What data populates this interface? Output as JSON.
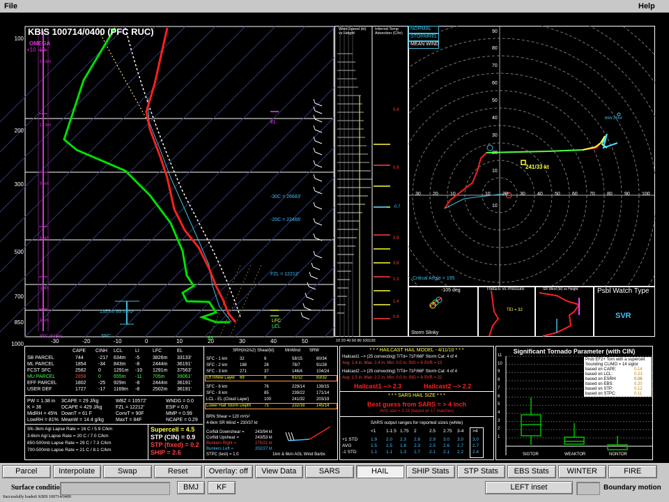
{
  "menu": {
    "file": "File",
    "help": "Help"
  },
  "skewt": {
    "title": "KBIS   100714/0400  (PFC RUC)",
    "omega_label": "OMEGA",
    "omega_scale": "+10   -10",
    "p_labels": [
      "100",
      "200",
      "300",
      "500",
      "700",
      "850",
      "1000"
    ],
    "t_labels": [
      "-30",
      "-20",
      "-10",
      "0",
      "10",
      "20",
      "30",
      "40",
      "50"
    ],
    "h_labels": [
      "15 km",
      "12 km",
      "9 km",
      "6 km",
      "3 km",
      "1 km",
      "SFC (532m)"
    ],
    "ann": {
      "el": "EL",
      "m30": "-30C = 26683'",
      "m20": "-20C = 22466'",
      "fzl": "FZL = 12212'",
      "lfc": "LFC",
      "lcl": "LCL",
      "sfc": "SFC",
      "srh": "1357m   69 m²/s²",
      "sixty": "63"
    }
  },
  "wind": {
    "label": "Wind Speed (kt) vs Height",
    "axis": "10 20 40 60 80 100120"
  },
  "tadv": {
    "label": "Inferred Temp Advection (C/hr)",
    "vals": [
      "0.4",
      "0.9",
      "-0.7",
      "3.9",
      "3.9",
      "2.3",
      "1.4",
      "0.9"
    ]
  },
  "hodo": {
    "tabs": [
      "NORMAL",
      "STORMREL",
      "MEAN WIND"
    ],
    "y_ticks": [
      "90",
      "80",
      "70",
      "60",
      "50",
      "40",
      "30",
      "20",
      "10",
      "10"
    ],
    "x_ticks": [
      "30",
      "20",
      "10",
      "10",
      "20",
      "30",
      "40",
      "50",
      "60",
      "70",
      "80",
      "90",
      "100"
    ],
    "mark": "241/33 kt",
    "critical": "Critical Angle = 195",
    "brn": "BRN 24/54"
  },
  "thetae": {
    "angle": "-105 deg",
    "title": "Theta-E vs Pressure",
    "tei": "TEI = 32",
    "slinky": "Storm Slinky",
    "p": [
      "-500",
      "-600",
      "-700",
      "-800",
      "-900"
    ]
  },
  "srwind": {
    "title": "SR Wind (kt) vs Height"
  },
  "watch": {
    "title": "Psbl Watch Type",
    "value": "SVR"
  },
  "params": {
    "header": [
      "CAPE",
      "CINH",
      "LCL",
      "LI",
      "LFC",
      "EL"
    ],
    "rows": [
      [
        "SB PARCEL",
        "744",
        "-217",
        "634m",
        "-5",
        "3826m",
        "33133'"
      ],
      [
        "ML PARCEL",
        "1854",
        "-34",
        "843m",
        "-8",
        "2444m",
        "36191'"
      ],
      [
        "FCST SFC",
        "2582",
        "0",
        "1291m",
        "-10",
        "1291m",
        "37563'"
      ],
      [
        "MU PARCEL",
        "2858",
        "0",
        "655m",
        "-11",
        "705m",
        "39061'"
      ],
      [
        "EFF PARCEL",
        "1802",
        "-25",
        "929m",
        "-8",
        "2444m",
        "36191'"
      ],
      [
        "USER DEF",
        "1727",
        "-17",
        "1169m",
        "-8",
        "2502m",
        "36191'"
      ]
    ],
    "idx": [
      [
        "PW = 1.38 in",
        "3CAPE = 29 J/kg",
        "WBZ = 10572'",
        "WNDG = 0.0"
      ],
      [
        "K = 36",
        "DCAPE = 429 J/kg",
        "FZL = 12212'",
        "ESP = 0.0"
      ],
      [
        "MidRH = 45%",
        "DownT = 61 F",
        "ConvT = 90F",
        "MMP = 0.99"
      ],
      [
        "LowRH = 81%",
        "MeanW = 14.4 g/kg",
        "MaxT = 84F",
        "NCAPE = 0.29"
      ]
    ],
    "lapse": [
      "Sfc-3km Agl Lapse Rate = 16 C / 5.9 C/km",
      "3-6km Agl Lapse Rate = 20 C / 7.0 C/km",
      "850-500mb Lapse Rate = 29 C / 7.3 C/km",
      "700-500mb Lapse Rate = 21 C / 8.1 C/km"
    ],
    "comp": [
      "Supercell = 4.5",
      "STP (CIN) = 0.9",
      "STP (fixed) = 0.2",
      "SHIP = 2.6"
    ],
    "srh_header": [
      "SRH(m2/s2)",
      "Shear(kt)",
      "MnWind",
      "SRW"
    ],
    "srh": [
      [
        "SFC - 1 km",
        "32",
        "6",
        "58/15",
        "80/34"
      ],
      [
        "SFC - 2 km",
        "188",
        "28",
        "78/7",
        "91/28"
      ],
      [
        "SFC - 3 km",
        "271",
        "37",
        "146/4",
        "104/24"
      ],
      [
        "Eff Inflow Layer",
        "69",
        "8",
        "61/12",
        "83/32"
      ],
      [
        "SFC - 6 km",
        "",
        "76",
        "229/14",
        "139/15"
      ],
      [
        "SFC - 8 km",
        "",
        "85",
        "239/22",
        "171/14"
      ],
      [
        "LCL - EL (Cloud Layer)",
        "",
        "100",
        "241/32",
        "203/19"
      ],
      [
        "Lower Half Storm Depth",
        "",
        "75",
        "232/16",
        "145/14"
      ]
    ],
    "brn": [
      "BRN Shear = 120 m²/s²",
      "4-6km SR Wind = 230/37 kt"
    ],
    "motions": [
      [
        "Corfidi Downshear =",
        "243/94 kt"
      ],
      [
        "Corfidi Upshear =",
        "243/53 kt"
      ],
      [
        "Bunkers Right =",
        "275/21 kt"
      ],
      [
        "Bunkers Left =",
        "202/27 kt"
      ]
    ],
    "stpc": "STPC (test) = 1.0",
    "barbs": "1km & 6km AGL Wind Barbs"
  },
  "hail": {
    "title": "* * * HAILCAST HAIL MODEL - 4/11/10 * * *",
    "lines": [
      "Hailcast1 --> (25 convecting)   T/Td= 71F/66F   Storm Cat: 4 of 4",
      "Avg: 1.4 in.   Max: 2.4 in.   Min: 0.0 in.   SIG = 6   SVR = 13",
      "Hailcast2 --> (25 convecting)   T/Td= 71F/66F   Storm Cat: 4 of 4",
      "Avg: 1.5 in.   Max: 2.2 in.   Min: 0.0 in.   SIG = 6   SVR = 22"
    ],
    "h1": "Hailcast1 --> 2.3",
    "h2": "Hailcast2 --> 2.2",
    "sars_title": "* * * SARS HAIL SIZE * * *",
    "sars_guess": "Best guess from SARS = > 4 inch",
    "sars_avg": "AVG size = 3.19 (based on 17 matches)",
    "ranges_title": "SARS output ranges for reported sizes (white)",
    "cols": [
      "<1",
      "1-1.5",
      "1.75",
      "2",
      "2.5",
      "2.75",
      "3-4",
      ">4"
    ],
    "rows": [
      [
        "+1 STD",
        "1.9",
        "2.0",
        "2.3",
        "2.8",
        "2.9",
        "3.0",
        "3.0",
        "3.0"
      ],
      [
        "AVG",
        "1.5",
        "1.5",
        "1.8",
        "2.3",
        "2.5",
        "2.6",
        "2.7",
        "2.7"
      ],
      [
        "-1 STD",
        "1.1",
        "1.1",
        "1.3",
        "1.7",
        "2.1",
        "2.1",
        "2.2",
        "2.4"
      ]
    ]
  },
  "stp": {
    "title": "Significant Tornado Parameter (with CIN)",
    "hdr1": "Prob EF2+ Torn with a supercell",
    "hdr2": "Sounding CLIMO = 14 sigtor",
    "rows": [
      [
        "based on CAPE:",
        "0.14"
      ],
      [
        "based on LCL:",
        "0.23"
      ],
      [
        "based on ESRH:",
        "0.06"
      ],
      [
        "based on EBS:",
        "0.20"
      ],
      [
        "based on STP:",
        "0.12"
      ],
      [
        "based on STPC:",
        "0.11"
      ]
    ],
    "y": [
      "11",
      "10",
      "9",
      "8",
      "7",
      "6",
      "5",
      "4",
      "3",
      "2",
      "1"
    ],
    "x": [
      "SIGTOR",
      "WEAKTOR",
      "NONTOR"
    ]
  },
  "buttons": [
    "Parcel",
    "Interpolate",
    "Swap",
    "Reset",
    "Overlay: off",
    "View Data",
    "SARS",
    "HAIL",
    "SHIP Stats",
    "STP Stats",
    "EBS Stats",
    "WINTER",
    "FIRE"
  ],
  "bottom": {
    "surface": "Surface conditions",
    "bmj": "BMJ",
    "kf": "KF",
    "left_inset": "LEFT inset",
    "boundary": "Boundary motion",
    "status": "Successfully loaded: KBIS  100714/0400"
  }
}
